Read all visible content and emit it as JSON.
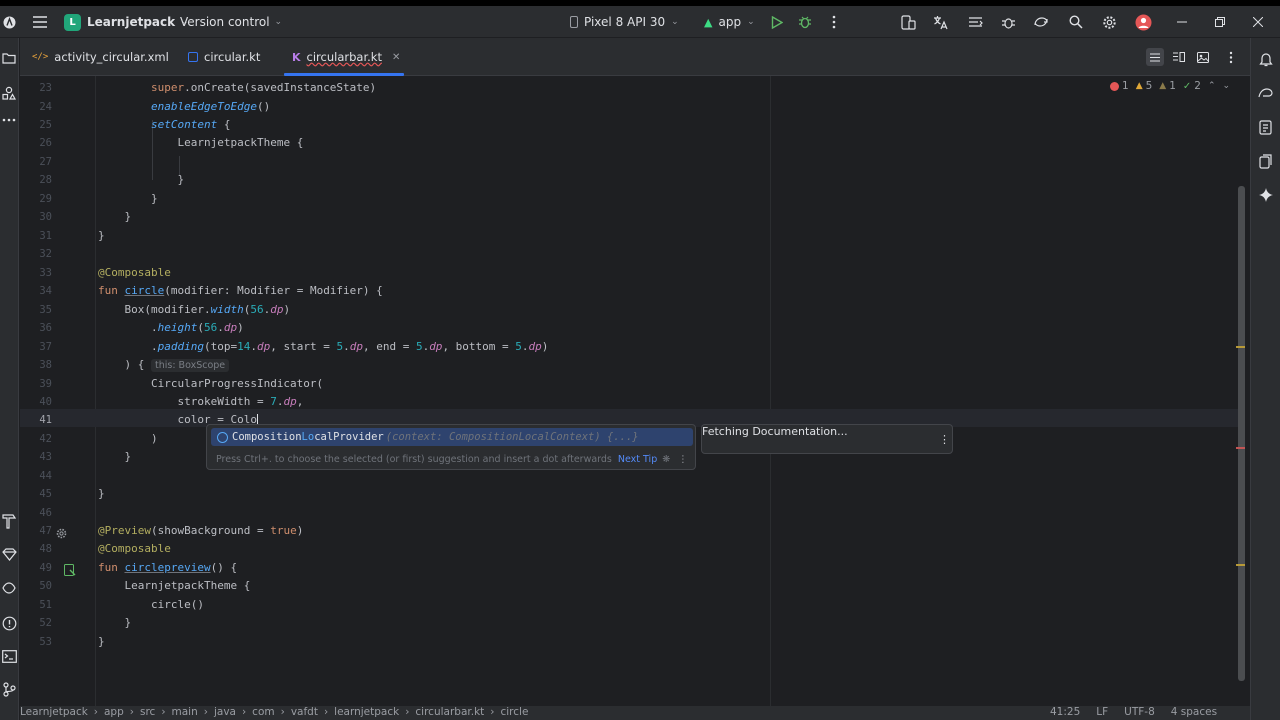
{
  "titlebar": {
    "project_badge": "L",
    "project_name": "Learnjetpack",
    "vcs": "Version control",
    "device": "Pixel 8 API 30",
    "run_config": "app"
  },
  "tabs": [
    {
      "label": "activity_circular.xml",
      "icon": "xml-icon"
    },
    {
      "label": "circular.kt",
      "icon": "kotlin-file-icon"
    },
    {
      "label": "circularbar.kt",
      "icon": "kotlin-file-icon",
      "active": true
    }
  ],
  "inspections": {
    "errors": "1",
    "warnings": "5",
    "weak": "1",
    "typos": "2"
  },
  "gutter": [
    "23",
    "24",
    "25",
    "26",
    "27",
    "28",
    "29",
    "30",
    "31",
    "32",
    "33",
    "34",
    "35",
    "36",
    "37",
    "38",
    "39",
    "40",
    "41",
    "42",
    "43",
    "44",
    "45",
    "46",
    "47",
    "48",
    "49",
    "50",
    "51",
    "52",
    "53"
  ],
  "code": {
    "l23a": "super",
    ".l23b": "",
    "l23c": ".onCreate(savedInstanceState)",
    "l24": "enableEdgeToEdge",
    "l24b": "()",
    "l25": "setContent",
    "l25b": " {",
    "l26": "LearnjetpackTheme {",
    "l28": "}",
    "l29": "}",
    "l30": "}",
    "l31": "}",
    "l33": "@Composable",
    "l34a": "fun ",
    "l34b": "circle",
    "l34c": "(modifier: Modifier = Modifier) {",
    "l35a": "Box(modifier.",
    "l35b": "width",
    "l35c": "(",
    "l35d": "56",
    "l35e": ".",
    "l35f": "dp",
    "l35g": ")",
    "l36a": ".",
    "l36b": "height",
    "l36c": "(",
    "l36d": "56",
    "l36e": ".",
    "l36f": "dp",
    "l36g": ")",
    "l37a": ".",
    "l37b": "padding",
    "l37c": "(top=",
    "l37d": "14",
    "l37e": ".",
    "l37f": "dp",
    "l37g": ", start = ",
    "l37h": "5",
    "l37i": ".",
    "l37j": "dp",
    "l37k": ", end = ",
    "l37l": "5",
    "l37m": ".",
    "l37n": "dp",
    "l37o": ", bottom = ",
    "l37p": "5",
    "l37q": ".",
    "l37r": "dp",
    "l37s": ")",
    "l38": ") {",
    "l38hint": "this: BoxScope",
    "l39": "CircularProgressIndicator(",
    "l40a": "strokeWidth",
    "l40b": " = ",
    "l40c": "7",
    "l40d": ".",
    "l40e": "dp",
    "l40f": ",",
    "l41a": "color",
    "l41b": " = Colo",
    "l42": ")",
    "l43": "}",
    "l45": "}",
    "l47a": "@Preview",
    "l47b": "(showBackground = ",
    "l47c": "true",
    "l47d": ")",
    "l48": "@Composable",
    "l49a": "fun ",
    "l49b": "circlepreview",
    "l49c": "() {",
    "l50": "LearnjetpackTheme {",
    "l51": "circle()",
    "l52": "}",
    "l53": "}"
  },
  "completion": {
    "item_name_pre": "Composition",
    "item_name_match": "Lo",
    "item_name_post": "calProvider",
    "item_params": "(context: CompositionLocalContext) {...}",
    "hint": "Press Ctrl+. to choose the selected (or first) suggestion and insert a dot afterwards",
    "next_tip": "Next Tip"
  },
  "doc_popup": {
    "text": "Fetching Documentation..."
  },
  "statusbar": {
    "crumbs": [
      "Learnjetpack",
      "app",
      "src",
      "main",
      "java",
      "com",
      "vafdt",
      "learnjetpack",
      "circularbar.kt",
      "circle"
    ],
    "position": "41:25",
    "line_sep": "LF",
    "encoding": "UTF-8",
    "indent": "4 spaces"
  }
}
